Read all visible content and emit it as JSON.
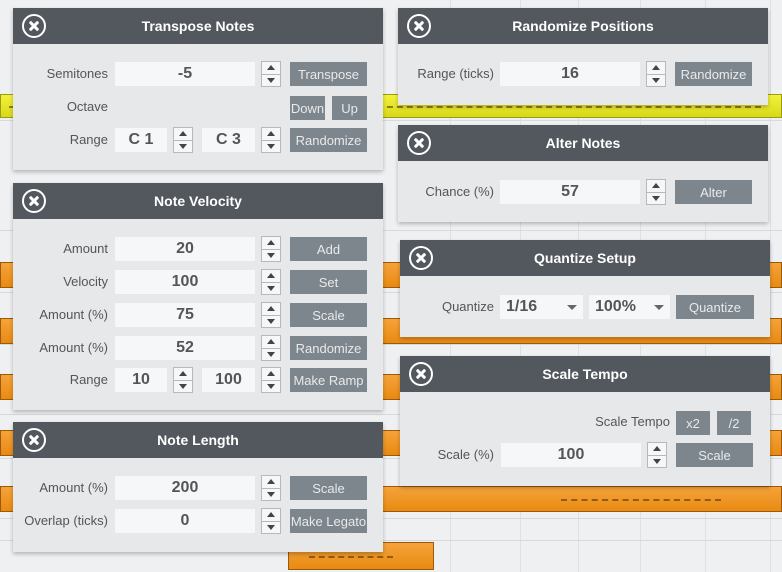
{
  "transpose": {
    "title": "Transpose Notes",
    "semitones_label": "Semitones",
    "semitones_value": "-5",
    "transpose_btn": "Transpose",
    "octave_label": "Octave",
    "down_btn": "Down",
    "up_btn": "Up",
    "range_label": "Range",
    "range_from": "C 1",
    "range_to": "C 3",
    "randomize_btn": "Randomize"
  },
  "velocity": {
    "title": "Note Velocity",
    "rows": [
      {
        "label": "Amount",
        "value": "20",
        "button": "Add"
      },
      {
        "label": "Velocity",
        "value": "100",
        "button": "Set"
      },
      {
        "label": "Amount (%)",
        "value": "75",
        "button": "Scale"
      },
      {
        "label": "Amount (%)",
        "value": "52",
        "button": "Randomize"
      }
    ],
    "range_label": "Range",
    "range_from": "10",
    "range_to": "100",
    "ramp_btn": "Make Ramp"
  },
  "length": {
    "title": "Note Length",
    "amount_label": "Amount (%)",
    "amount_value": "200",
    "scale_btn": "Scale",
    "overlap_label": "Overlap (ticks)",
    "overlap_value": "0",
    "legato_btn": "Make Legato"
  },
  "randomize_positions": {
    "title": "Randomize Positions",
    "range_label": "Range (ticks)",
    "range_value": "16",
    "randomize_btn": "Randomize"
  },
  "alter": {
    "title": "Alter Notes",
    "chance_label": "Chance (%)",
    "chance_value": "57",
    "alter_btn": "Alter"
  },
  "quantize": {
    "title": "Quantize Setup",
    "quantize_label": "Quantize",
    "grid_value": "1/16",
    "strength_value": "100%",
    "quantize_btn": "Quantize"
  },
  "scale_tempo": {
    "title": "Scale Tempo",
    "tempo_label": "Scale Tempo",
    "x2_btn": "x2",
    "half_btn": "/2",
    "scale_label": "Scale (%)",
    "scale_value": "100",
    "scale_btn": "Scale"
  }
}
